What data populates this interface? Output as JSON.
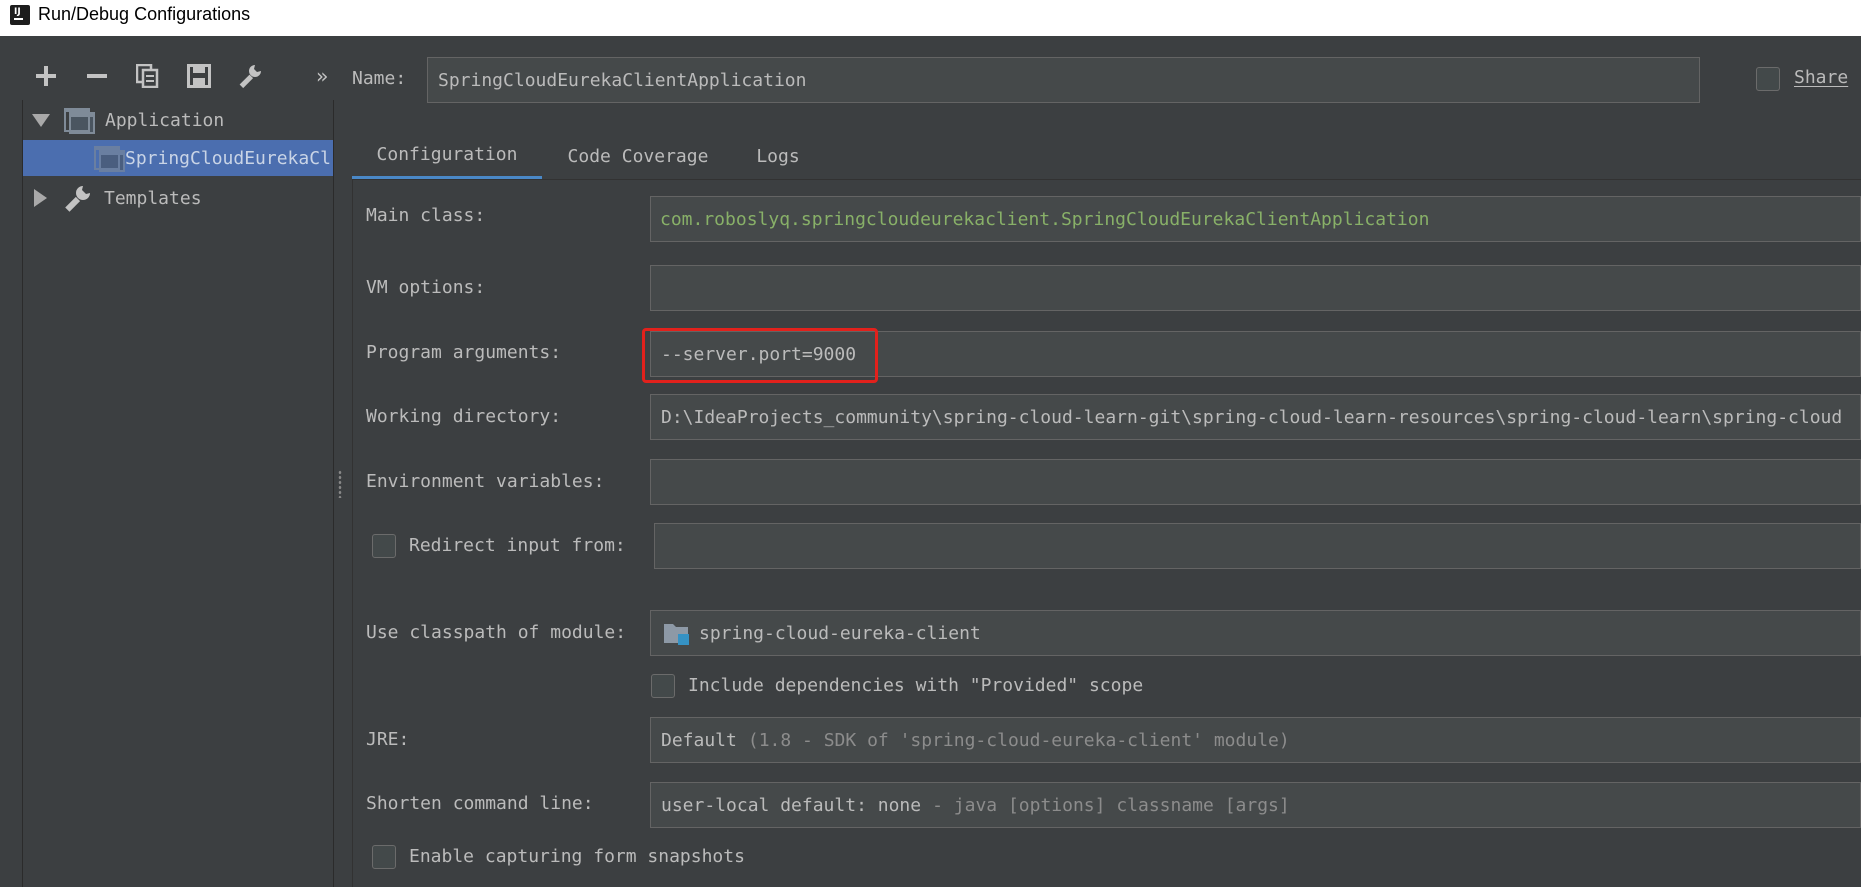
{
  "window": {
    "title": "Run/Debug Configurations",
    "app_icon_text": "IJ"
  },
  "toolbar": {
    "add": "add-icon",
    "remove": "remove-icon",
    "copy": "copy-icon",
    "save": "save-icon",
    "edit_defaults": "wrench-icon",
    "more": "»"
  },
  "tree": {
    "application_label": "Application",
    "child_label": "SpringCloudEurekaCl",
    "templates_label": "Templates"
  },
  "header": {
    "name_label": "Name:",
    "name_value": "SpringCloudEurekaClientApplication",
    "share_label": "Share"
  },
  "tabs": [
    {
      "label": "Configuration",
      "active": true
    },
    {
      "label": "Code Coverage",
      "active": false
    },
    {
      "label": "Logs",
      "active": false
    }
  ],
  "form": {
    "main_class_label": "Main class:",
    "main_class_value": "com.roboslyq.springcloudeurekaclient.SpringCloudEurekaClientApplication",
    "vm_options_label": "VM options:",
    "vm_options_value": "",
    "program_args_label": "Program arguments:",
    "program_args_value": "--server.port=9000",
    "working_dir_label": "Working directory:",
    "working_dir_value": "D:\\IdeaProjects_community\\spring-cloud-learn-git\\spring-cloud-learn-resources\\spring-cloud-learn\\spring-cloud",
    "env_vars_label": "Environment variables:",
    "env_vars_value": "",
    "redirect_label": "Redirect input from:",
    "classpath_label": "Use classpath of module:",
    "classpath_value": "spring-cloud-eureka-client",
    "include_deps_label": "Include dependencies with \"Provided\" scope",
    "jre_label": "JRE:",
    "jre_value_main": "Default",
    "jre_value_detail": "(1.8 - SDK of 'spring-cloud-eureka-client' module)",
    "shorten_label": "Shorten command line:",
    "shorten_value_main": "user-local default: none",
    "shorten_value_detail": "- java [options] classname [args]",
    "snapshots_label": "Enable capturing form snapshots"
  },
  "colors": {
    "background": "#3c3f41",
    "selected": "#4b6eaf",
    "field": "#45494a",
    "tab_underline": "#4a88c7",
    "highlight_box": "#e2211c",
    "main_class_text": "#88b068"
  }
}
